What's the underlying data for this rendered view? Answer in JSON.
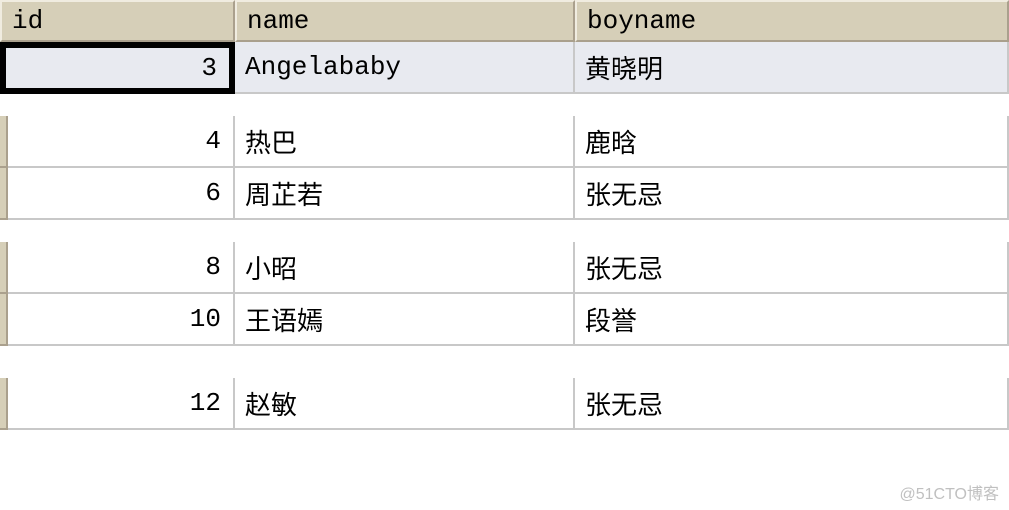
{
  "table": {
    "headers": {
      "id": "id",
      "name": "name",
      "boyname": "boyname"
    },
    "rows": [
      {
        "id": "3",
        "name": "Angelababy",
        "boyname": "黄晓明",
        "selected": true
      },
      {
        "id": "4",
        "name": "热巴",
        "boyname": "鹿晗",
        "selected": false
      },
      {
        "id": "6",
        "name": "周芷若",
        "boyname": "张无忌",
        "selected": false
      },
      {
        "id": "8",
        "name": "小昭",
        "boyname": "张无忌",
        "selected": false
      },
      {
        "id": "10",
        "name": "王语嫣",
        "boyname": "段誉",
        "selected": false
      },
      {
        "id": "12",
        "name": "赵敏",
        "boyname": "张无忌",
        "selected": false
      }
    ]
  },
  "watermark": "@51CTO博客"
}
